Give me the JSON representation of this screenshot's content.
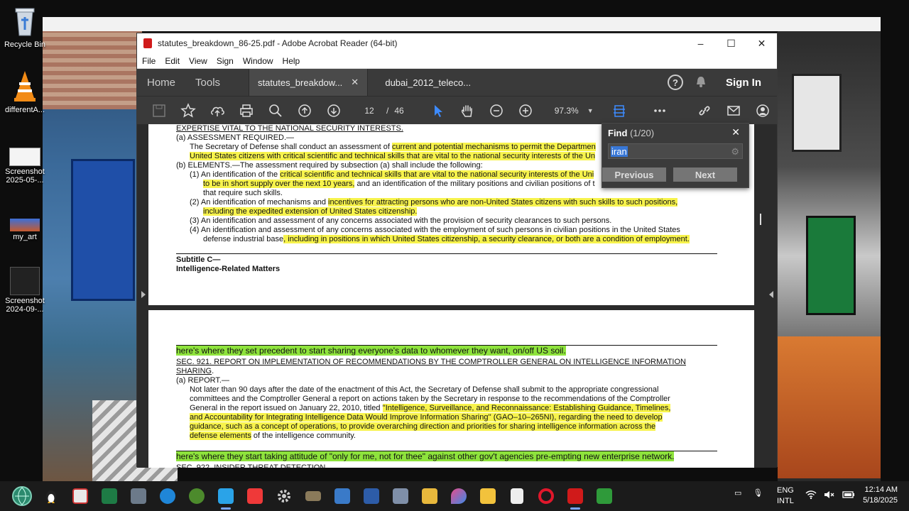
{
  "desktop": {
    "icons": [
      {
        "label": "Recycle Bin"
      },
      {
        "label": "differentA..."
      },
      {
        "label": "Screenshot 2025-05-..."
      },
      {
        "label": "my_art"
      },
      {
        "label": "Screenshot 2024-09-..."
      }
    ]
  },
  "window": {
    "title": "statutes_breakdown_86-25.pdf - Adobe Acrobat Reader (64-bit)",
    "menu": [
      "File",
      "Edit",
      "View",
      "Sign",
      "Window",
      "Help"
    ],
    "nav": {
      "home": "Home",
      "tools": "Tools"
    },
    "tabs": [
      {
        "label": "statutes_breakdow...",
        "active": true
      },
      {
        "label": "dubai_2012_teleco...",
        "active": false
      }
    ],
    "signin": "Sign In",
    "toolbar": {
      "current_page": "12",
      "page_sep": "/",
      "total_pages": "46",
      "zoom": "97.3%"
    }
  },
  "find": {
    "title": "Find",
    "count": "(1/20)",
    "query": "iran",
    "previous": "Previous",
    "next": "Next"
  },
  "document": {
    "page1": [
      {
        "id": "l1",
        "parts": [
          {
            "t": "EXPERTISE VITAL TO THE NATIONAL SECURITY INTERESTS.",
            "s": "ul"
          }
        ]
      },
      {
        "id": "l2",
        "parts": [
          {
            "t": "(a) ASSESSMENT REQUIRED.—"
          }
        ]
      },
      {
        "id": "l3",
        "parts": [
          {
            "t": "The Secretary of Defense shall conduct an assessment of "
          },
          {
            "t": "current and potential mechanisms to permit the Departmen",
            "s": "hl"
          }
        ]
      },
      {
        "id": "l4",
        "parts": [
          {
            "t": "United States citizens with critical scientific and technical skills that are vital to the national security interests of the Un",
            "s": "hl"
          }
        ]
      },
      {
        "id": "l5",
        "parts": [
          {
            "t": "(b) ELEMENTS.—The assessment required by subsection (a) shall include the following:"
          }
        ]
      },
      {
        "id": "l6",
        "parts": [
          {
            "t": "(1) An identification of the "
          },
          {
            "t": "critical scientific and technical skills that are vital to the national security interests of the Uni",
            "s": "hl"
          }
        ]
      },
      {
        "id": "l7",
        "parts": [
          {
            "t": "to be in short supply over the next 10 years,",
            "s": "hl"
          },
          {
            "t": " and an identification of the military positions and civilian positions of t"
          }
        ]
      },
      {
        "id": "l8",
        "parts": [
          {
            "t": "that require such skills."
          }
        ]
      },
      {
        "id": "l9",
        "parts": [
          {
            "t": "(2) An identification of mechanisms and "
          },
          {
            "t": "incentives for attracting persons who are non-United States citizens with such skills to such positions,",
            "s": "hl"
          }
        ]
      },
      {
        "id": "l10",
        "parts": [
          {
            "t": "including the expedited extension of United States citizenship.",
            "s": "hl"
          }
        ]
      },
      {
        "id": "l11",
        "parts": [
          {
            "t": "(3) An identification and assessment of any concerns associated with the provision of security clearances to such persons."
          }
        ]
      },
      {
        "id": "l12",
        "parts": [
          {
            "t": "(4) An identification and assessment of any concerns associated with the employment of such persons in civilian positions in the United States"
          }
        ]
      },
      {
        "id": "l13",
        "parts": [
          {
            "t": "defense industrial base"
          },
          {
            "t": ", including in positions in which United States citizenship, a security clearance, or both are a condition of employment.",
            "s": "hl"
          }
        ]
      },
      {
        "id": "l14",
        "parts": [
          {
            "t": "Subtitle C—",
            "s": "b"
          }
        ]
      },
      {
        "id": "l15",
        "parts": [
          {
            "t": "Intelligence-Related Matters",
            "s": "b"
          }
        ]
      }
    ],
    "page2": [
      {
        "id": "m1",
        "parts": [
          {
            "t": "here's where they set precedent to start sharing everyone's data to whomever they want, on/off US soil.",
            "s": "hlg"
          }
        ]
      },
      {
        "id": "m2",
        "parts": [
          {
            "t": "SEC. 921. REPORT ON IMPLEMENTATION OF RECOMMENDATIONS BY THE COMPTROLLER GENERAL ON INTELLIGENCE INFORMATION",
            "s": "ul"
          }
        ]
      },
      {
        "id": "m3",
        "parts": [
          {
            "t": "SHARING",
            "s": "ul"
          },
          {
            "t": "."
          }
        ]
      },
      {
        "id": "m4",
        "parts": [
          {
            "t": "(a) REPORT.—"
          }
        ]
      },
      {
        "id": "m5",
        "parts": [
          {
            "t": "Not later than 90 days after the date of the enactment of this Act, the Secretary of Defense shall submit to the appropriate congressional"
          }
        ]
      },
      {
        "id": "m6",
        "parts": [
          {
            "t": "committees and the Comptroller General a report on actions taken by the Secretary in response to the recommendations of the Comptroller"
          }
        ]
      },
      {
        "id": "m7",
        "parts": [
          {
            "t": "General in the report issued on January 22, 2010, titled "
          },
          {
            "t": "''Intelligence, Surveillance, and Reconnaissance: Establishing Guidance, Timelines,",
            "s": "hl"
          }
        ]
      },
      {
        "id": "m8",
        "parts": [
          {
            "t": "and Accountability for Integrating Intelligence Data Would Improve Information Sharing'' (GAO–10–265NI), regarding the need to develop",
            "s": "hl"
          }
        ]
      },
      {
        "id": "m9",
        "parts": [
          {
            "t": "guidance, such as a concept of operations, to provide overarching direction and priorities for sharing intelligence information across the",
            "s": "hl"
          }
        ]
      },
      {
        "id": "m10",
        "parts": [
          {
            "t": "defense elements",
            "s": "hl"
          },
          {
            "t": " of the intelligence community."
          }
        ]
      },
      {
        "id": "m11",
        "parts": [
          {
            "t": "here's where they start taking attitude of \"only for me, not for thee\" against other gov't agencies pre-empting new enterprise network.",
            "s": "hlg"
          }
        ]
      },
      {
        "id": "m12",
        "parts": [
          {
            "t": "SEC. 922. INSIDER THREAT DETECTION.",
            "s": "ul"
          }
        ]
      }
    ]
  },
  "taskbar": {
    "lang1": "ENG",
    "lang2": "INTL",
    "time": "12:14 AM",
    "date": "5/18/2025"
  }
}
